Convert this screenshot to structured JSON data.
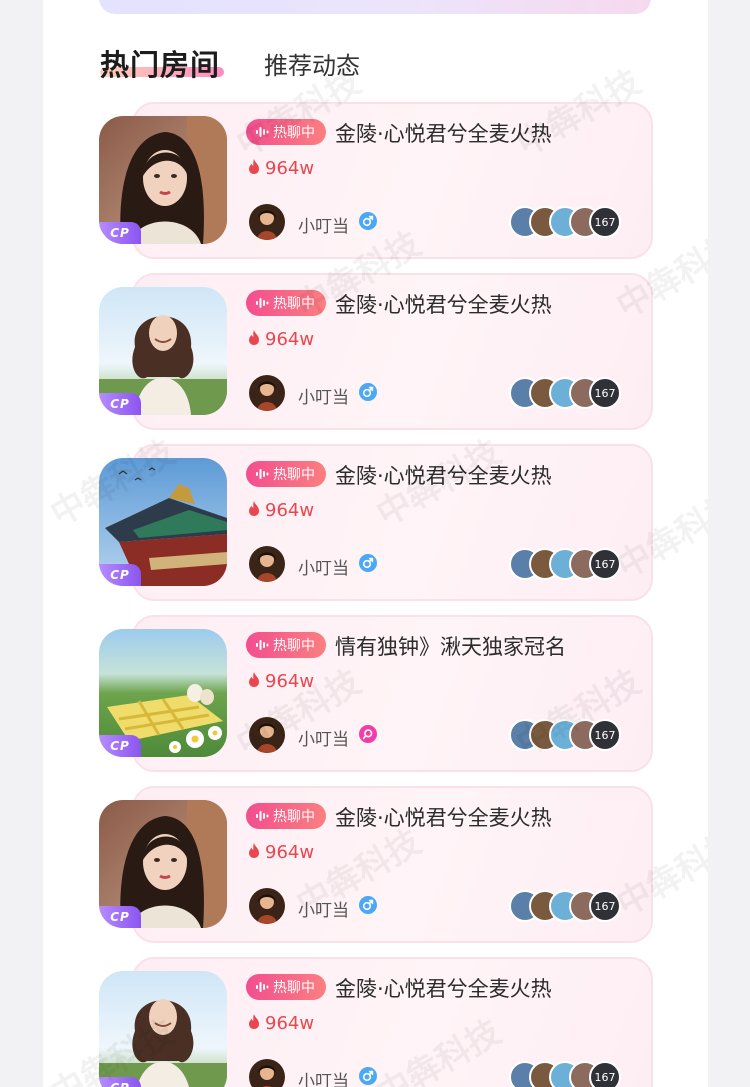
{
  "tabs": {
    "active": "热门房间",
    "inactive": "推荐动态"
  },
  "tag_label": "热聊中",
  "badge_label": "CP",
  "watermark": "中犇科技",
  "colors": {
    "accent": "#f24e8f",
    "heat": "#e9474f",
    "male": "#4aa8f5",
    "female": "#f13ea6"
  },
  "rooms": [
    {
      "title": "金陵·心悦君兮全麦火热",
      "heat": "964w",
      "owner": "小叮当",
      "gender": "male",
      "gender_icon": "male-icon",
      "member_count": "167",
      "cover": "portrait-girl"
    },
    {
      "title": "金陵·心悦君兮全麦火热",
      "heat": "964w",
      "owner": "小叮当",
      "gender": "male",
      "gender_icon": "male-icon",
      "member_count": "167",
      "cover": "girl-field"
    },
    {
      "title": "金陵·心悦君兮全麦火热",
      "heat": "964w",
      "owner": "小叮当",
      "gender": "male",
      "gender_icon": "male-icon",
      "member_count": "167",
      "cover": "palace"
    },
    {
      "title": "情有独钟》湫天独家冠名",
      "heat": "964w",
      "owner": "小叮当",
      "gender": "female",
      "gender_icon": "female-icon",
      "member_count": "167",
      "cover": "picnic"
    },
    {
      "title": "金陵·心悦君兮全麦火热",
      "heat": "964w",
      "owner": "小叮当",
      "gender": "male",
      "gender_icon": "male-icon",
      "member_count": "167",
      "cover": "portrait-girl"
    },
    {
      "title": "金陵·心悦君兮全麦火热",
      "heat": "964w",
      "owner": "小叮当",
      "gender": "male",
      "gender_icon": "male-icon",
      "member_count": "167",
      "cover": "girl-field"
    }
  ]
}
